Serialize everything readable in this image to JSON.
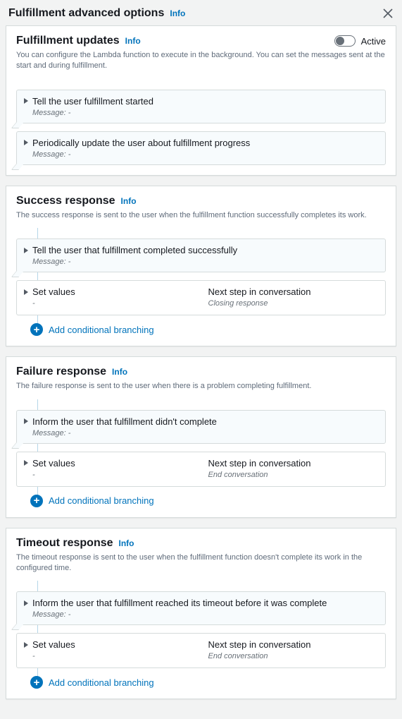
{
  "header": {
    "title": "Fulfillment advanced options",
    "info": "Info"
  },
  "common": {
    "info": "Info",
    "message_label": "Message: -",
    "set_values": "Set values",
    "set_values_sub": "-",
    "next_step": "Next step in conversation",
    "add_branch": "Add conditional branching"
  },
  "updates": {
    "title": "Fulfillment updates",
    "desc": "You can configure the Lambda function to execute in the background. You can set the messages sent at the start and during fulfillment.",
    "toggle_label": "Active",
    "row1": "Tell the user fulfillment started",
    "row2": "Periodically update the user about fulfillment progress"
  },
  "success": {
    "title": "Success response",
    "desc": "The success response is sent to the user when the fulfillment function successfully completes its work.",
    "row1": "Tell the user that fulfillment completed successfully",
    "next_sub": "Closing response"
  },
  "failure": {
    "title": "Failure response",
    "desc": "The failure response is sent to the user when there is a problem completing fulfillment.",
    "row1": "Inform the user that fulfillment didn't complete",
    "next_sub": "End conversation"
  },
  "timeout": {
    "title": "Timeout response",
    "desc": "The timeout response is sent to the user when the fulfillment function doesn't complete its work in the configured time.",
    "row1": "Inform the user that fulfillment reached its timeout before it was complete",
    "next_sub": "End conversation"
  }
}
